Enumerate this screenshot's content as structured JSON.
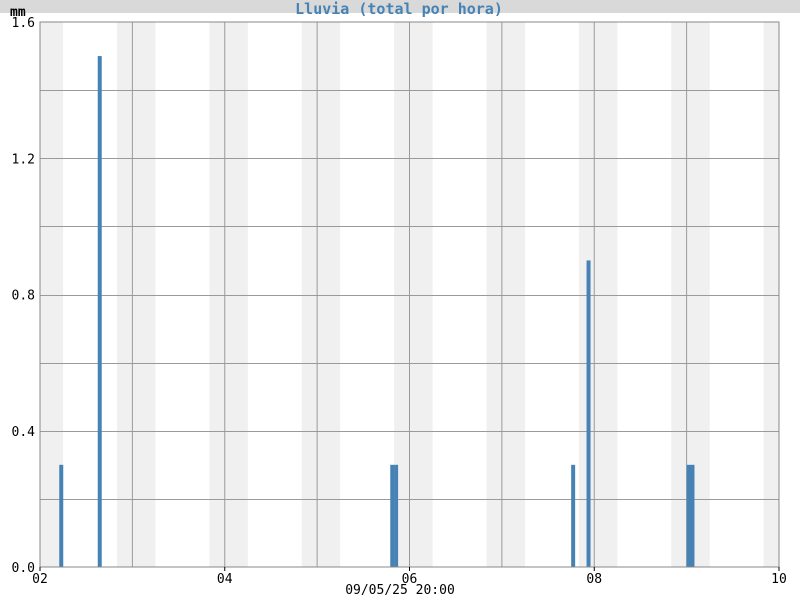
{
  "chart_data": {
    "type": "bar",
    "title": "Lluvia (total por hora)",
    "ylabel": "mm",
    "xlabel": "09/05/25 20:00",
    "ylim": [
      0,
      1.6
    ],
    "xlim_days": [
      2,
      10
    ],
    "y_ticks": [
      "0.0",
      "0.4",
      "0.8",
      "1.2",
      "1.6"
    ],
    "x_ticks": [
      "02",
      "04",
      "06",
      "08",
      "10"
    ],
    "bar_color": "#4682b4",
    "shade_color": "#f0f0f0",
    "title_color": "#4682b4",
    "title_band_color": "#d9d9d9",
    "grid": true,
    "bars": [
      {
        "x": "02 06:00",
        "value": 0.3
      },
      {
        "x": "02 16:00",
        "value": 1.5
      },
      {
        "x": "05 20:00",
        "value": 0.3
      },
      {
        "x": "05 21:00",
        "value": 0.3
      },
      {
        "x": "07 19:00",
        "value": 0.3
      },
      {
        "x": "07 23:00",
        "value": 0.9
      },
      {
        "x": "09 01:00",
        "value": 0.3
      },
      {
        "x": "09 02:00",
        "value": 0.3
      }
    ],
    "night_periods": [
      {
        "start": "02 00:00",
        "end": "02 06:00"
      },
      {
        "start": "02 20:00",
        "end": "03 06:00"
      },
      {
        "start": "03 20:00",
        "end": "04 06:00"
      },
      {
        "start": "04 20:00",
        "end": "05 06:00"
      },
      {
        "start": "05 20:00",
        "end": "06 06:00"
      },
      {
        "start": "06 20:00",
        "end": "07 06:00"
      },
      {
        "start": "07 20:00",
        "end": "08 06:00"
      },
      {
        "start": "08 20:00",
        "end": "09 06:00"
      },
      {
        "start": "09 20:00",
        "end": "10 00:00"
      }
    ]
  }
}
